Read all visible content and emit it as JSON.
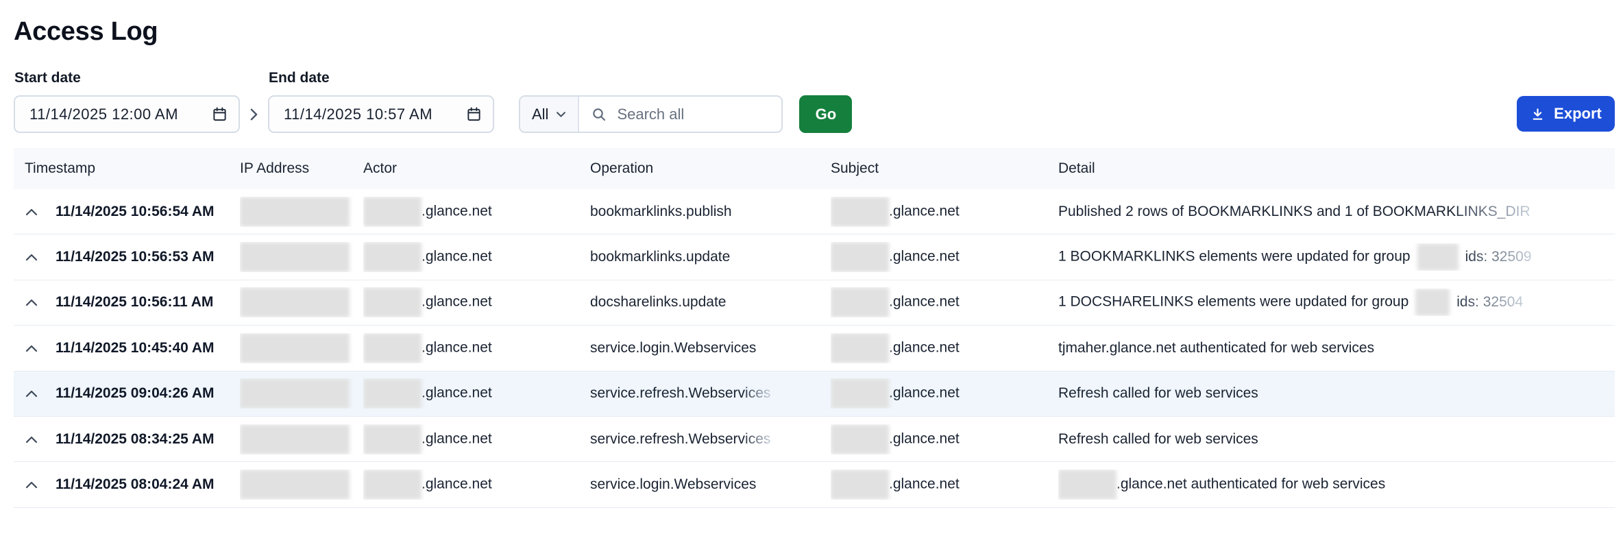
{
  "page": {
    "title": "Access Log"
  },
  "filters": {
    "start_label": "Start date",
    "end_label": "End date",
    "start_value": "11/14/2025 12:00 AM",
    "end_value": "11/14/2025 10:57 AM",
    "scope_value": "All",
    "search_placeholder": "Search all",
    "go_label": "Go",
    "export_label": "Export"
  },
  "colors": {
    "go_green": "#15803d",
    "export_blue": "#1c4ed8",
    "header_bg": "#f7f9fc",
    "highlight_row": "#f0f6fb",
    "faded_text": "#98a2b3",
    "text": "#101828"
  },
  "icons": {
    "export": "download-icon",
    "search": "search-icon",
    "scope": "chevron-down-icon",
    "range": "chevron-right-icon",
    "date": "calendar-icon",
    "row": "chevron-up-icon"
  },
  "table": {
    "columns": [
      "Timestamp",
      "IP Address",
      "Actor",
      "Operation",
      "Subject",
      "Detail"
    ],
    "rows": [
      {
        "timestamp": "11/14/2025 10:56:54 AM",
        "highlight": false,
        "ip": [
          {
            "redact": [
              160,
              44
            ]
          }
        ],
        "actor": [
          {
            "redact": [
              85,
              44
            ]
          },
          {
            "text": ".glance.net"
          }
        ],
        "operation": [
          {
            "text": "bookmarklinks.publish"
          }
        ],
        "subject": [
          {
            "redact": [
              85,
              44
            ]
          },
          {
            "text": ".glance.net"
          }
        ],
        "detail": [
          {
            "text": "Published 2 rows of BOOKMARKLINKS and 1 of BOOKMARK"
          },
          {
            "text": "LINKS_DIR",
            "fade": true
          }
        ]
      },
      {
        "timestamp": "11/14/2025 10:56:53 AM",
        "highlight": false,
        "ip": [
          {
            "redact": [
              160,
              44
            ]
          }
        ],
        "actor": [
          {
            "redact": [
              85,
              44
            ]
          },
          {
            "text": ".glance.net"
          }
        ],
        "operation": [
          {
            "text": "bookmarklinks.update"
          }
        ],
        "subject": [
          {
            "redact": [
              85,
              44
            ]
          },
          {
            "text": ".glance.net"
          }
        ],
        "detail": [
          {
            "text": "1 BOOKMARKLINKS elements were updated for group"
          },
          {
            "redact": [
              60,
              40
            ],
            "mid": true
          },
          {
            "text": "ids: 32509",
            "fade": true
          }
        ]
      },
      {
        "timestamp": "11/14/2025 10:56:11 AM",
        "highlight": false,
        "ip": [
          {
            "redact": [
              160,
              44
            ]
          }
        ],
        "actor": [
          {
            "redact": [
              85,
              44
            ]
          },
          {
            "text": ".glance.net"
          }
        ],
        "operation": [
          {
            "text": "docsharelinks.update"
          }
        ],
        "subject": [
          {
            "redact": [
              85,
              44
            ]
          },
          {
            "text": ".glance.net"
          }
        ],
        "detail": [
          {
            "text": "1 DOCSHARELINKS elements were updated for group"
          },
          {
            "redact": [
              50,
              40
            ],
            "mid": true
          },
          {
            "text": "ids: 32504",
            "fade": true
          }
        ]
      },
      {
        "timestamp": "11/14/2025 10:45:40 AM",
        "highlight": false,
        "ip": [
          {
            "redact": [
              160,
              44
            ]
          }
        ],
        "actor": [
          {
            "redact": [
              85,
              44
            ]
          },
          {
            "text": ".glance.net"
          }
        ],
        "operation": [
          {
            "text": "service.login.Webservices"
          }
        ],
        "subject": [
          {
            "redact": [
              85,
              44
            ]
          },
          {
            "text": ".glance.net"
          }
        ],
        "detail": [
          {
            "text": "tjmaher.glance.net authenticated for web services"
          }
        ]
      },
      {
        "timestamp": "11/14/2025 09:04:26 AM",
        "highlight": true,
        "ip": [
          {
            "redact": [
              160,
              44
            ]
          }
        ],
        "actor": [
          {
            "redact": [
              85,
              44
            ]
          },
          {
            "text": ".glance.net"
          }
        ],
        "operation": [
          {
            "text": "service.refresh.Webserv"
          },
          {
            "text": "ices",
            "fade": true
          }
        ],
        "subject": [
          {
            "redact": [
              85,
              44
            ]
          },
          {
            "text": ".glance.net"
          }
        ],
        "detail": [
          {
            "text": "Refresh called for web services"
          }
        ]
      },
      {
        "timestamp": "11/14/2025 08:34:25 AM",
        "highlight": false,
        "ip": [
          {
            "redact": [
              160,
              44
            ]
          }
        ],
        "actor": [
          {
            "redact": [
              85,
              44
            ]
          },
          {
            "text": ".glance.net"
          }
        ],
        "operation": [
          {
            "text": "service.refresh.Webserv"
          },
          {
            "text": "ices",
            "fade": true
          }
        ],
        "subject": [
          {
            "redact": [
              85,
              44
            ]
          },
          {
            "text": ".glance.net"
          }
        ],
        "detail": [
          {
            "text": "Refresh called for web services"
          }
        ]
      },
      {
        "timestamp": "11/14/2025 08:04:24 AM",
        "highlight": false,
        "ip": [
          {
            "redact": [
              160,
              44
            ]
          }
        ],
        "actor": [
          {
            "redact": [
              85,
              44
            ]
          },
          {
            "text": ".glance.net"
          }
        ],
        "operation": [
          {
            "text": "service.login.Webservices"
          }
        ],
        "subject": [
          {
            "redact": [
              85,
              44
            ]
          },
          {
            "text": ".glance.net"
          }
        ],
        "detail": [
          {
            "redact": [
              85,
              44
            ]
          },
          {
            "text": ".glance.net authenticated for web services"
          }
        ]
      }
    ]
  }
}
